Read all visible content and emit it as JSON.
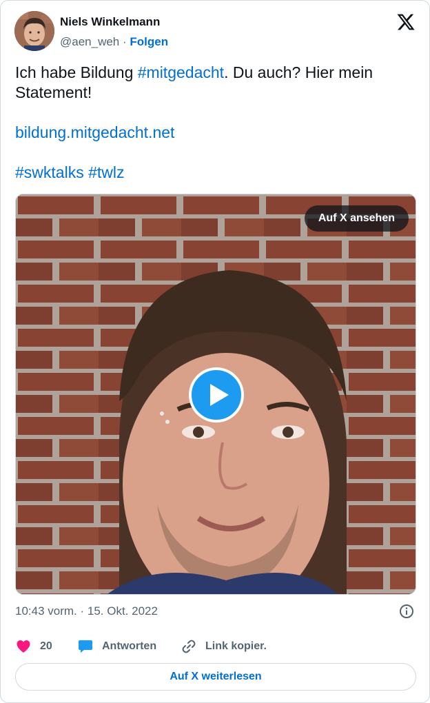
{
  "author": {
    "name": "Niels Winkelmann",
    "handle": "@aen_weh",
    "separator": " · ",
    "follow_label": "Folgen"
  },
  "tweet": {
    "text_before": "Ich habe Bildung ",
    "hashtag_1": "#mitgedacht",
    "text_after": ". Du auch? Hier mein Statement!",
    "link": "bildung.mitgedacht.net",
    "hashtag_2": "#swktalks",
    "hashtag_3": "#twlz"
  },
  "media": {
    "watch_label": "Auf X ansehen",
    "play_icon": "play-icon"
  },
  "meta": {
    "timestamp": "10:43 vorm. · 15. Okt. 2022"
  },
  "actions": {
    "likes_count": "20",
    "reply_label": "Antworten",
    "copy_label": "Link kopier."
  },
  "footer": {
    "read_more_label": "Auf X weiterlesen"
  },
  "colors": {
    "link": "#006fd6",
    "like": "#f91880",
    "reply": "#1d9bf0",
    "play": "#1d9bf0",
    "secondary_text": "#536471"
  }
}
